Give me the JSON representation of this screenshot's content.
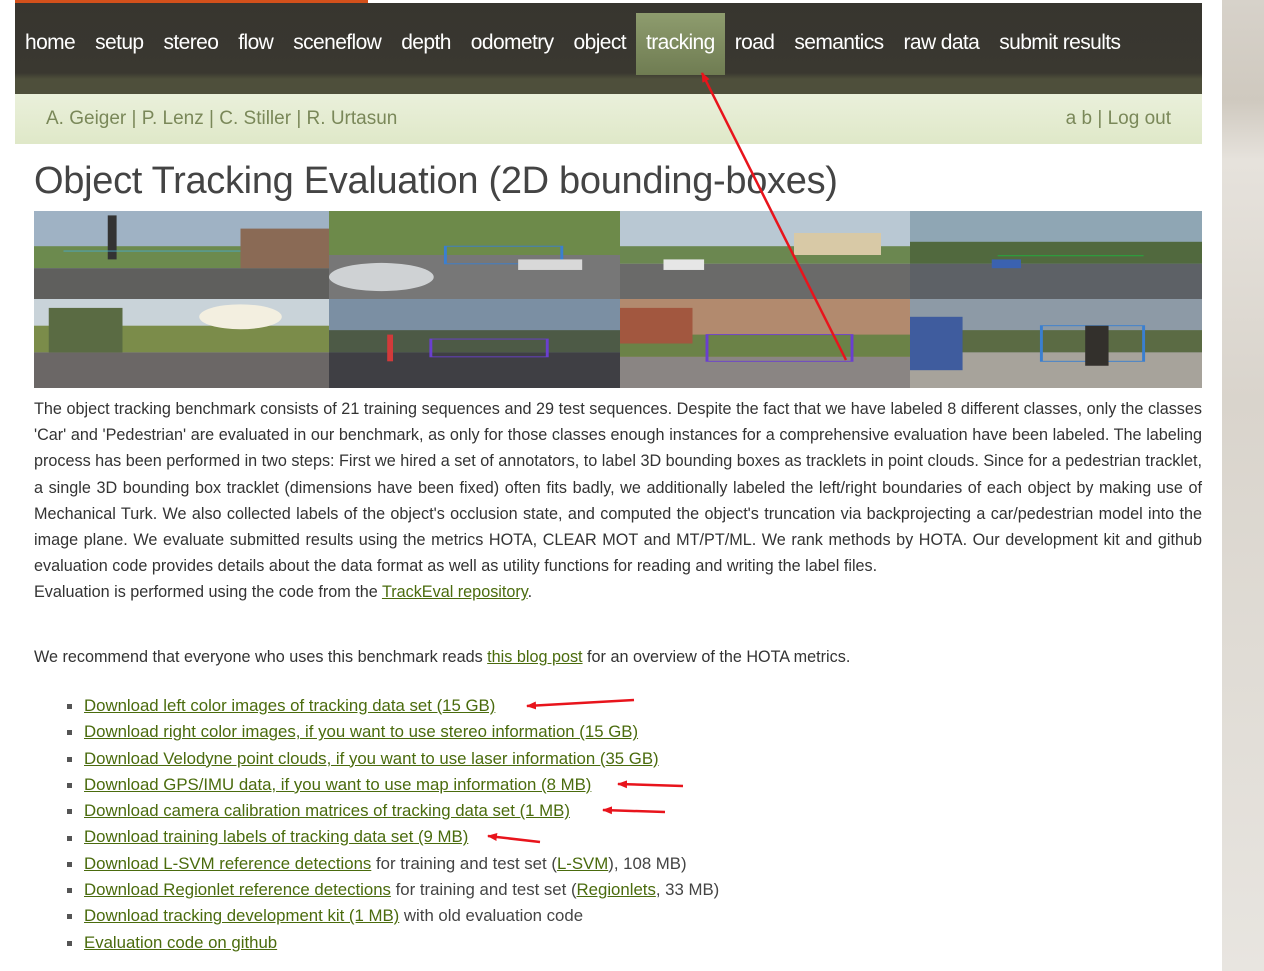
{
  "nav": {
    "items": [
      "home",
      "setup",
      "stereo",
      "flow",
      "sceneflow",
      "depth",
      "odometry",
      "object",
      "tracking",
      "road",
      "semantics",
      "raw data",
      "submit results"
    ],
    "active_index": 8
  },
  "subheader": {
    "authors": [
      "A. Geiger",
      "P. Lenz",
      "C. Stiller",
      "R. Urtasun"
    ],
    "separator": " | ",
    "user_link": "a b",
    "logout_link": "Log out"
  },
  "page_title": "Object Tracking Evaluation (2D bounding-boxes)",
  "description": {
    "paragraph": "The object tracking benchmark consists of 21 training sequences and 29 test sequences. Despite the fact that we have labeled 8 different classes, only the classes 'Car' and 'Pedestrian' are evaluated in our benchmark, as only for those classes enough instances for a comprehensive evaluation have been labeled. The labeling process has been performed in two steps: First we hired a set of annotators, to label 3D bounding boxes as tracklets in point clouds. Since for a pedestrian tracklet, a single 3D bounding box tracklet (dimensions have been fixed) often fits badly, we additionally labeled the left/right boundaries of each object by making use of Mechanical Turk. We also collected labels of the object's occlusion state, and computed the object's truncation via backprojecting a car/pedestrian model into the image plane. We evaluate submitted results using the metrics HOTA, CLEAR MOT and MT/PT/ML. We rank methods by HOTA. Our development kit and github evaluation code provides details about the data format as well as utility functions for reading and writing the label files.",
    "eval_prefix": "Evaluation is performed using the code from the ",
    "eval_link": "TrackEval repository",
    "eval_suffix": "."
  },
  "recommend": {
    "prefix": "We recommend that everyone who uses this benchmark reads ",
    "link": "this blog post",
    "suffix": " for an overview of the HOTA metrics."
  },
  "downloads": [
    {
      "link": "Download left color images of tracking data set (15 GB)",
      "after": ""
    },
    {
      "link": "Download right color images, if you want to use stereo information (15 GB)",
      "after": ""
    },
    {
      "link": "Download Velodyne point clouds, if you want to use laser information (35 GB)",
      "after": ""
    },
    {
      "link": "Download GPS/IMU data, if you want to use map information (8 MB)",
      "after": ""
    },
    {
      "link": "Download camera calibration matrices of tracking data set (1 MB)",
      "after": ""
    },
    {
      "link": "Download training labels of tracking data set (9 MB)",
      "after": ""
    },
    {
      "link": "Download L-SVM reference detections",
      "after": " for training and test set (",
      "link2": "L-SVM",
      "after2": "), 108 MB)"
    },
    {
      "link": "Download Regionlet reference detections",
      "after": " for training and test set (",
      "link2": "Regionlets",
      "after2": ", 33 MB)"
    },
    {
      "link": "Download tracking development kit (1 MB)",
      "after": " with old evaluation code"
    },
    {
      "link": "Evaluation code on github",
      "after": ""
    }
  ],
  "colors": {
    "nav_bg": "#37352f",
    "nav_active": "#7f8c5f",
    "accent": "#d3501b",
    "link": "#4a6b0d",
    "subheader_text": "#7a8859",
    "annotation_arrow": "#e8141c"
  }
}
